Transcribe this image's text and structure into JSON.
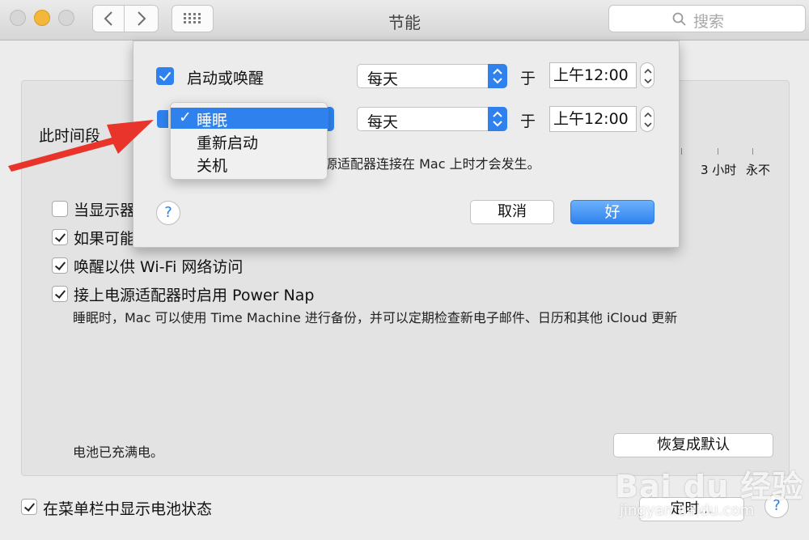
{
  "window": {
    "title": "节能"
  },
  "toolbar": {
    "search_placeholder": "搜索",
    "back_icon": "chevron-left-icon",
    "forward_icon": "chevron-right-icon",
    "grid_icon": "grid-icon"
  },
  "panel": {
    "partial_label": "此时间段",
    "slider_labels": [
      "3 小时",
      "永不"
    ],
    "options": [
      {
        "label": "当显示器",
        "checked": false
      },
      {
        "label": "如果可能",
        "checked": true
      },
      {
        "label": "唤醒以供 Wi-Fi 网络访问",
        "checked": true
      },
      {
        "label": "接上电源适配器时启用 Power Nap",
        "checked": true
      }
    ],
    "power_nap_desc": "睡眠时，Mac 可以使用 Time Machine 进行备份，并可以定期检查新电子邮件、日历和其他 iCloud 更新",
    "battery_status": "电池已充满电。",
    "restore_defaults": "恢复成默认",
    "show_battery_label": "在菜单栏中显示电池状态",
    "schedule_button": "定时..."
  },
  "sheet": {
    "row1": {
      "label": "启动或唤醒",
      "frequency": "每天",
      "at": "于",
      "time": "上午12:00"
    },
    "row2": {
      "frequency": "每天",
      "at": "于",
      "time": "上午12:00"
    },
    "note": "源适配器连接在 Mac 上时才会发生。",
    "cancel": "取消",
    "ok": "好"
  },
  "menu": {
    "items": [
      {
        "label": "睡眠",
        "selected": true
      },
      {
        "label": "重新启动",
        "selected": false
      },
      {
        "label": "关机",
        "selected": false
      }
    ]
  },
  "watermark": {
    "brand": "Bai du 经验",
    "url": "jingyan.baidu.com"
  },
  "colors": {
    "accent": "#2f82ee",
    "arrow": "#e8342a"
  }
}
